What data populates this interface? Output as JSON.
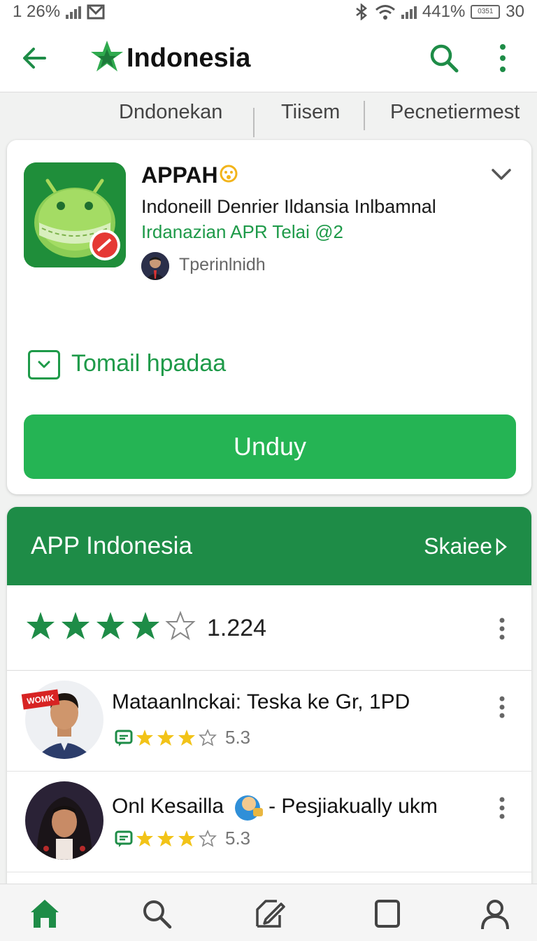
{
  "status_bar": {
    "time": "1 26%",
    "battery": "441%",
    "battery_label": "0351",
    "clock": "30"
  },
  "app_bar": {
    "title": "Indonesia",
    "back_icon": "arrow-left-icon",
    "logo_icon": "star-logo-icon",
    "search_icon": "search-icon",
    "more_icon": "more-vertical-icon"
  },
  "sub_tabs": [
    "Dndonekan",
    "Tiisem",
    "Pecnetiermest"
  ],
  "app_card": {
    "name": "APPAH",
    "description": "Indoneill Denrier Ildansia Inlbamnal",
    "developer": "Irdanazian APR Telai @2",
    "publisher": "Tperinlnidh",
    "expand_label": "Tomail hpadaa",
    "install_label": "Unduy",
    "icon": "android-app-icon"
  },
  "reviews_section": {
    "title": "APP Indonesia",
    "link_label": "Skaiee",
    "rating": {
      "stars_filled": 4,
      "stars_total": 5,
      "count": "1.224"
    },
    "reviews": [
      {
        "title": "Mataanlnckai: Teska ke Gr, 1PD",
        "stars_filled": 3,
        "stars_total": 4,
        "score": "5.3",
        "avatar_badge": "WOMK"
      },
      {
        "title_before": "Onl Kesailla",
        "title_after": "- Pesjiakually ukm",
        "stars_filled": 3,
        "stars_total": 4,
        "score": "5.3"
      }
    ]
  },
  "bottom_nav": [
    "home-icon",
    "search-icon",
    "edit-icon",
    "square-icon",
    "profile-icon"
  ],
  "colors": {
    "primary_green": "#1e8c47",
    "button_green": "#25b454",
    "star_green": "#1e8c47",
    "star_yellow": "#f2c318"
  }
}
